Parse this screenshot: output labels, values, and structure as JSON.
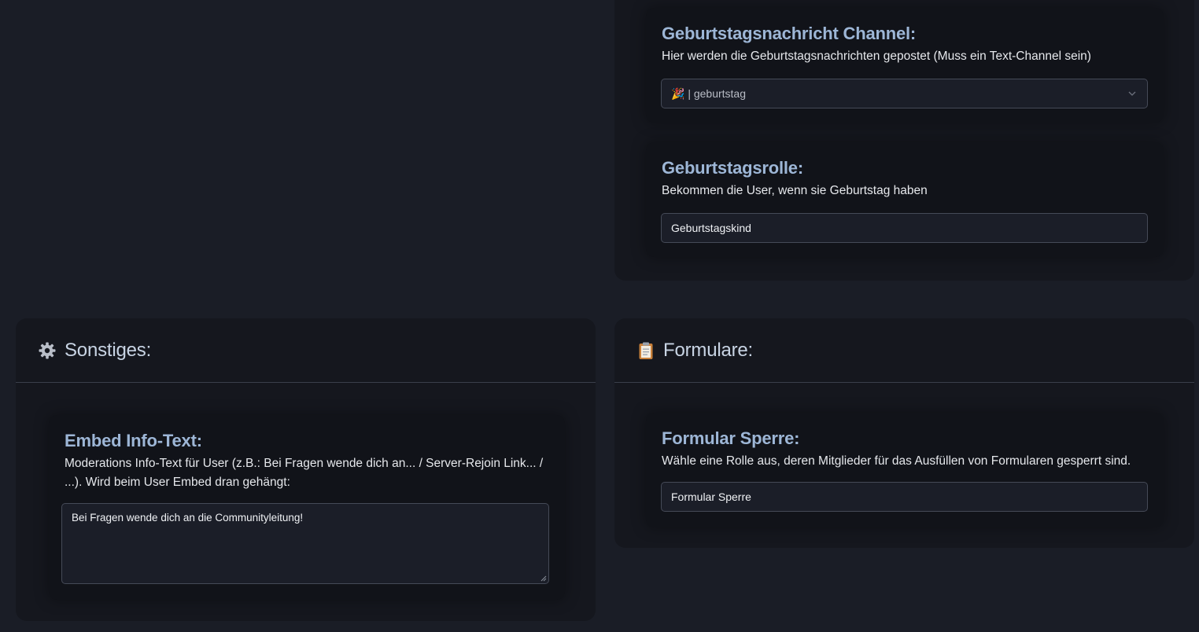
{
  "birthday": {
    "channel": {
      "title": "Geburtstagsnachricht Channel:",
      "description": "Hier werden die Geburtstagsnachrichten gepostet (Muss ein Text-Channel sein)",
      "selected_value": "🎉 | geburtstag"
    },
    "role": {
      "title": "Geburtstagsrolle:",
      "description": "Bekommen die User, wenn sie Geburtstag haben",
      "value": "Geburtstagskind"
    }
  },
  "misc": {
    "title": "Sonstiges:",
    "icon": "gear-icon",
    "embed_info": {
      "title": "Embed Info-Text:",
      "description": "Moderations Info-Text für User (z.B.: Bei Fragen wende dich an... / Server-Rejoin Link... / ...). Wird beim User Embed dran gehängt:",
      "value": "Bei Fragen wende dich an die Communityleitung!"
    }
  },
  "forms": {
    "title": "Formulare:",
    "icon": "clipboard-icon",
    "lock": {
      "title": "Formular Sperre:",
      "description": "Wähle eine Rolle aus, deren Mitglieder für das Ausfüllen von Formularen gesperrt sind.",
      "value": "Formular Sperre"
    }
  },
  "colors": {
    "background": "#1a1d26",
    "panel": "#15171e",
    "card": "#111319",
    "accent_title": "#9db6d6"
  }
}
